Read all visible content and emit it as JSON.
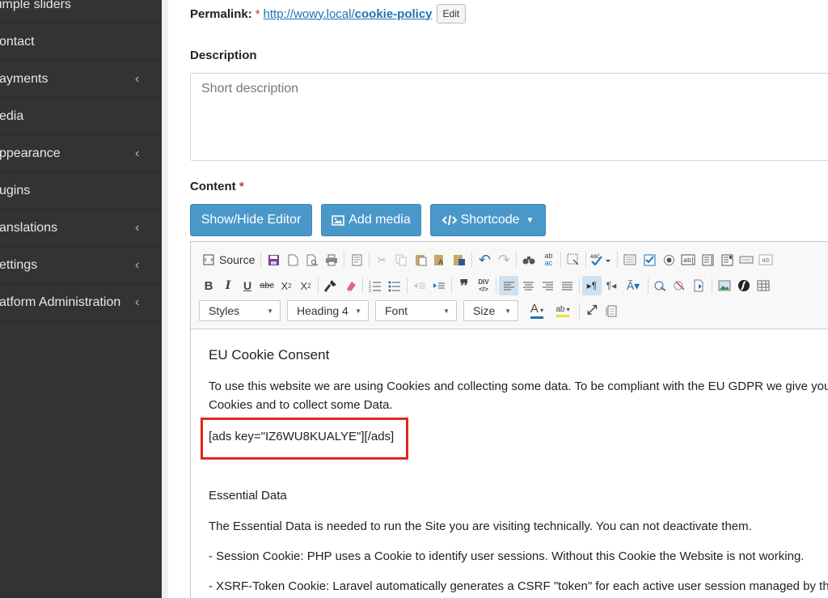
{
  "sidebar": {
    "items": [
      {
        "label": "imple sliders",
        "chevron": false
      },
      {
        "label": "ontact",
        "chevron": false
      },
      {
        "label": "ayments",
        "chevron": true
      },
      {
        "label": "edia",
        "chevron": false
      },
      {
        "label": "ppearance",
        "chevron": true
      },
      {
        "label": "ugins",
        "chevron": false
      },
      {
        "label": "anslations",
        "chevron": true
      },
      {
        "label": "ettings",
        "chevron": true
      },
      {
        "label": "atform Administration",
        "chevron": true
      }
    ]
  },
  "permalink": {
    "label": "Permalink:",
    "required": "*",
    "url_prefix": "http://wowy.local/",
    "slug": "cookie-policy",
    "edit_label": "Edit"
  },
  "description": {
    "label": "Description",
    "placeholder": "Short description"
  },
  "content": {
    "label": "Content",
    "required": "*",
    "buttons": {
      "show_hide": "Show/Hide Editor",
      "add_media": "Add media",
      "shortcode": "Shortcode"
    }
  },
  "toolbar": {
    "source_label": "Source",
    "styles_label": "Styles",
    "format_label": "Heading 4",
    "font_label": "Font",
    "size_label": "Size"
  },
  "editor_content": {
    "heading": "EU Cookie Consent",
    "para1_line1": "To use this website we are using Cookies and collecting some data. To be compliant with the EU GDPR we give you to",
    "para1_line2": "Cookies and to collect some Data.",
    "shortcode": "[ads key=\"IZ6WU8KUALYE\"][/ads]",
    "section_title": "Essential Data",
    "para2": "The Essential Data is needed to run the Site you are visiting technically. You can not deactivate them.",
    "para3": "- Session Cookie: PHP uses a Cookie to identify user sessions. Without this Cookie the Website is not working.",
    "para4": "- XSRF-Token Cookie: Laravel automatically generates a CSRF \"token\" for each active user session managed by the a"
  },
  "colors": {
    "sidebar_bg": "#333333",
    "button_blue": "#4a98c9",
    "link_blue": "#2271b1",
    "highlight_red": "#e0281f"
  }
}
